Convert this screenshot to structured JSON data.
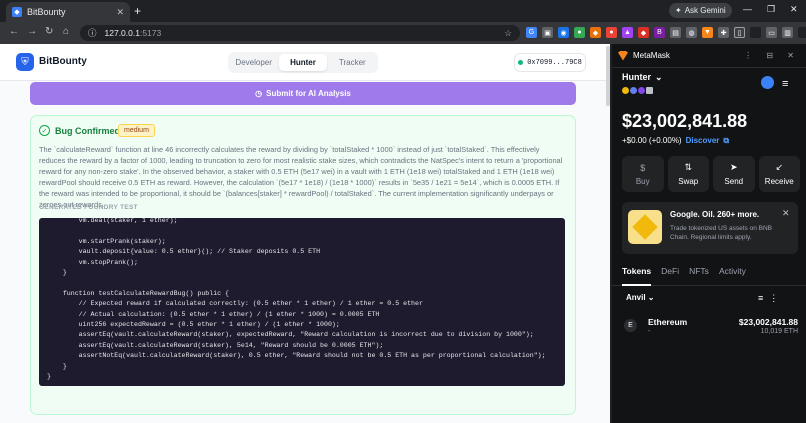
{
  "browser": {
    "tab_title": "BitBounty",
    "url_host": "127.0.0.1",
    "url_port": ":5173",
    "gemini_label": "Ask Gemini"
  },
  "app": {
    "brand": "BitBounty",
    "roles": [
      "Developer",
      "Hunter",
      "Tracker"
    ],
    "active_role": "Hunter",
    "wallet": "0x7099...79C8",
    "submit_label": "Submit for AI Analysis",
    "bug": {
      "title": "Bug Confirmed",
      "severity": "medium",
      "description": "The `calculateReward` function at line 46 incorrectly calculates the reward by dividing by `totalStaked * 1000` instead of just `totalStaked`. This effectively reduces the reward by a factor of 1000, leading to truncation to zero for most realistic stake sizes, which contradicts the NatSpec's intent to return a 'proportional reward for any non-zero stake'. In the observed behavior, a staker with 0.5 ETH (5e17 wei) in a vault with 1 ETH (1e18 wei) totalStaked and 1 ETH (1e18 wei) rewardPool should receive 0.5 ETH as reward. However, the calculation `(5e17 * 1e18) / (1e18 * 1000)` results in `5e35 / 1e21 = 5e14`, which is 0.0005 ETH. If the reward was intended to be proportional, it should be `(balances[staker] * rewardPool) / totalStaked`. The current implementation significantly underpays or zeroes out rewards.",
      "test_heading": "GENERATED FOUNDRY TEST",
      "code": "        vm.deal(staker, 1 ether);\n\n        vm.startPrank(staker);\n        vault.deposit{value: 0.5 ether}(); // Staker deposits 0.5 ETH\n        vm.stopPrank();\n    }\n\n    function testCalculateRewardBug() public {\n        // Expected reward if calculated correctly: (0.5 ether * 1 ether) / 1 ether = 0.5 ether\n        // Actual calculation: (0.5 ether * 1 ether) / (1 ether * 1000) = 0.0005 ETH\n        uint256 expectedReward = (0.5 ether * 1 ether) / (1 ether * 1000);\n        assertEq(vault.calculateReward(staker), expectedReward, \"Reward calculation is incorrect due to division by 1000\");\n        assertEq(vault.calculateReward(staker), 5e14, \"Reward should be 0.0005 ETH\");\n        assertNotEq(vault.calculateReward(staker), 0.5 ether, \"Reward should not be 0.5 ETH as per proportional calculation\");\n    }\n}"
    }
  },
  "metamask": {
    "title": "MetaMask",
    "account": "Hunter",
    "balance": "$23,002,841.88",
    "change": "+$0.00 (+0.00%)",
    "discover": "Discover",
    "actions": [
      "Buy",
      "Swap",
      "Send",
      "Receive"
    ],
    "promo_title": "Google. Oil. 260+ more.",
    "promo_text": "Trade tokenized US assets on BNB Chain. Regional limits apply.",
    "tabs": [
      "Tokens",
      "DeFi",
      "NFTs",
      "Activity"
    ],
    "network": "Anvil",
    "token": {
      "name": "Ethereum",
      "sub": "-",
      "value": "$23,002,841.88",
      "amount": "10,019 ETH"
    }
  }
}
